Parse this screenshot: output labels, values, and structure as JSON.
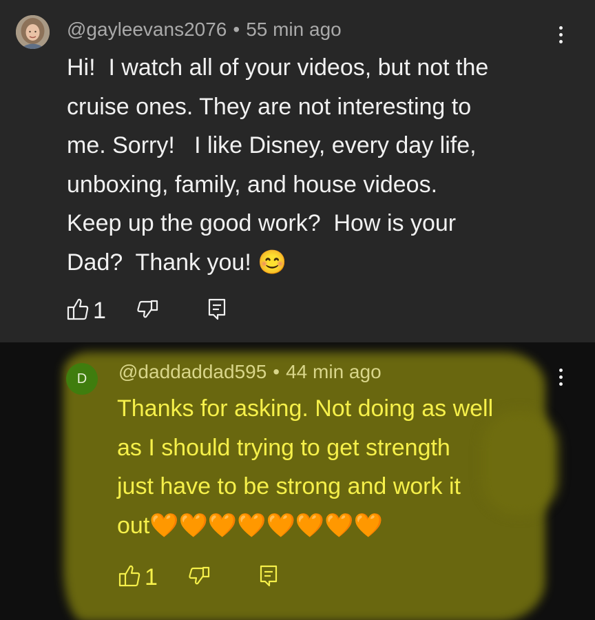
{
  "comments": [
    {
      "author": "@gayleevans2076",
      "separator": "•",
      "time": "55 min ago",
      "text": "Hi!  I watch all of your videos, but not the\ncruise ones. They are not interesting to\nme. Sorry!   I like Disney, every day life,\nunboxing, family, and house videos.\nKeep up the good work?  How is your\nDad?  Thank you! 😊",
      "likes": "1",
      "avatar_icon": "profile-photo"
    },
    {
      "author": "@daddaddad595",
      "separator": "•",
      "time": "44 min ago",
      "avatar_letter": "D",
      "text": "Thanks for asking. Not doing as well\nas I should trying to get strength\njust have to be strong and work it\nout🧡🧡🧡🧡🧡🧡🧡🧡",
      "likes": "1",
      "highlight_color": "#6e6c0f",
      "text_color": "#f6f04a"
    }
  ],
  "icons": {
    "like": "thumb-up-icon",
    "dislike": "thumb-down-icon",
    "reply": "reply-icon",
    "menu": "more-vert-icon"
  }
}
